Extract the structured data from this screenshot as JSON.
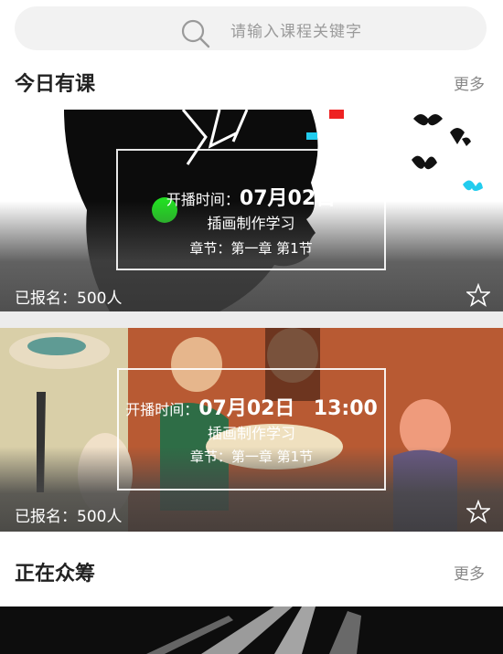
{
  "search": {
    "placeholder": "请输入课程关键字"
  },
  "today": {
    "title": "今日有课",
    "more": "更多",
    "courses": [
      {
        "time_label": "开播时间：",
        "date": "07月02日",
        "time": "",
        "course_name": "插画制作学习",
        "chapter": "章节：第一章 第1节",
        "enrolled": "已报名：500人"
      },
      {
        "time_label": "开播时间：",
        "date": "07月02日",
        "time": "13:00",
        "course_name": "插画制作学习",
        "chapter": "章节：第一章 第1节",
        "enrolled": "已报名：500人"
      }
    ]
  },
  "crowdfunding": {
    "title": "正在众筹",
    "more": "更多"
  }
}
